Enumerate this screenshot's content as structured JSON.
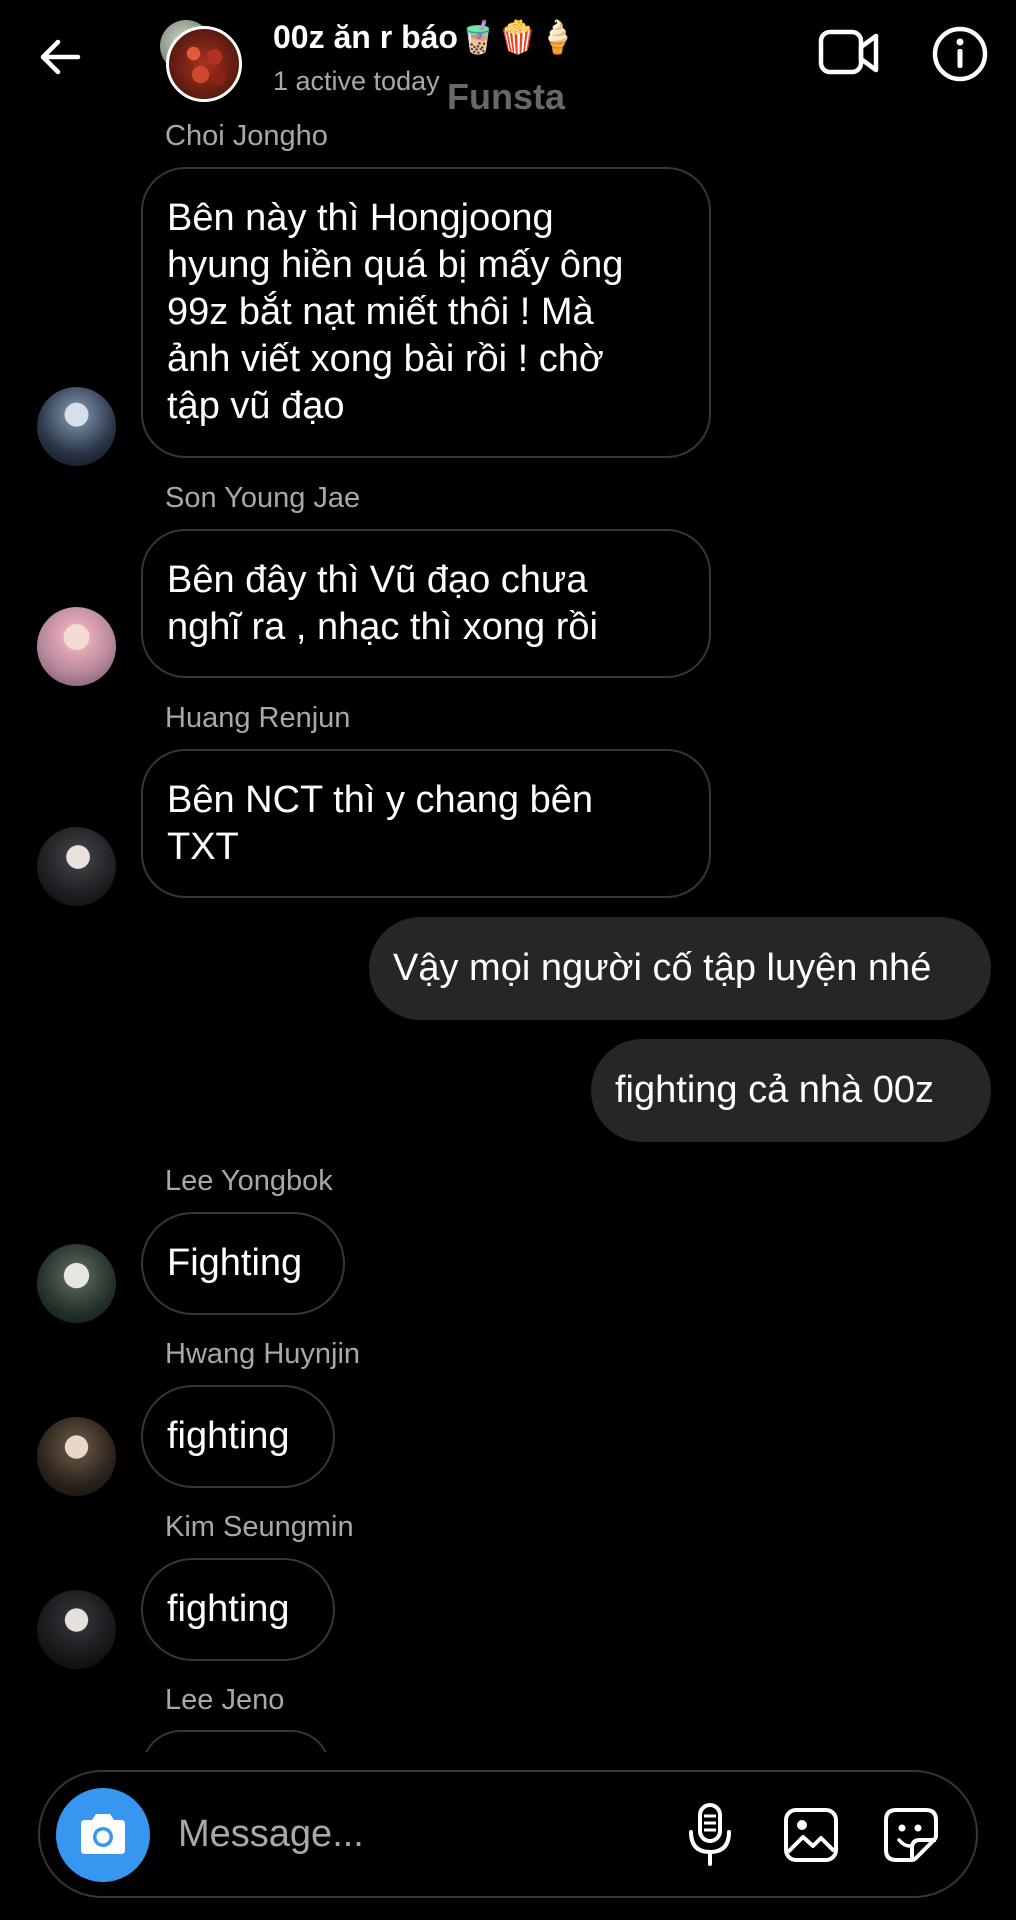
{
  "header": {
    "title": "00z ăn r báo🧋🍿🍦",
    "status": "1 active today",
    "watermark": "Funsta"
  },
  "icons": {
    "back": "arrow-left-icon",
    "video": "video-camera-icon",
    "info": "info-icon",
    "camera": "camera-icon",
    "mic": "microphone-icon",
    "gallery": "image-gallery-icon",
    "sticker": "sticker-icon"
  },
  "colors": {
    "background": "#000000",
    "incoming_border": "#363636",
    "outgoing_bubble": "#262626",
    "secondary_text": "#a8a8a8",
    "camera_button": "#3797f0"
  },
  "messages": [
    {
      "sender": "Choi Jongho",
      "text": "Bên này thì Hongjoong\nhyung hiền quá bị mấy ông\n99z bắt nạt miết thôi ! Mà\nảnh viết xong bài rồi ! chờ\ntập vũ đạo"
    },
    {
      "sender": "Son Young Jae",
      "text": "Bên đây thì Vũ đạo chưa\nnghĩ ra , nhạc thì xong rồi"
    },
    {
      "sender": "Huang Renjun",
      "text": "Bên NCT thì y chang bên\nTXT"
    },
    {
      "outgoing": true,
      "text": "Vậy mọi người cố tập luyện nhé"
    },
    {
      "outgoing": true,
      "text": "fighting cả nhà 00z"
    },
    {
      "sender": "Lee Yongbok",
      "text": "Fighting"
    },
    {
      "sender": "Hwang Huynjin",
      "text": "fighting"
    },
    {
      "sender": "Kim Seungmin",
      "text": "fighting"
    },
    {
      "sender": "Lee Jeno",
      "text": ""
    }
  ],
  "composer": {
    "placeholder": "Message..."
  }
}
